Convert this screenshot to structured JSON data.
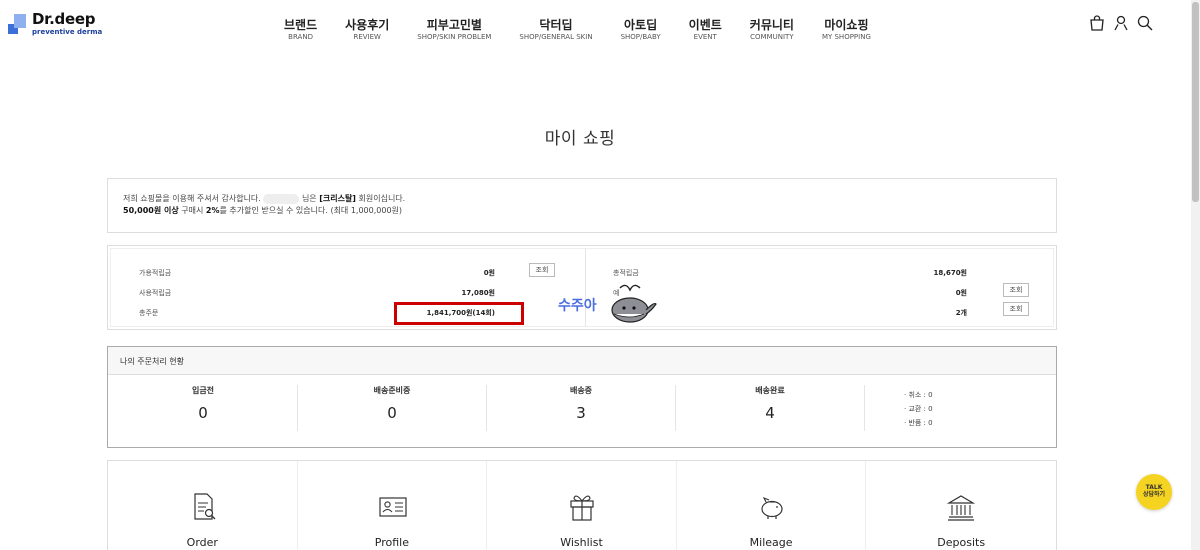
{
  "header": {
    "logo_text": "Dr.deep",
    "logo_sub": "preventive derma",
    "nav": [
      {
        "kr": "브랜드",
        "en": "BRAND"
      },
      {
        "kr": "사용후기",
        "en": "REVIEW"
      },
      {
        "kr": "피부고민별",
        "en": "SHOP/SKIN PROBLEM"
      },
      {
        "kr": "닥터딥",
        "en": "SHOP/GENERAL SKIN"
      },
      {
        "kr": "아토딥",
        "en": "SHOP/BABY"
      },
      {
        "kr": "이벤트",
        "en": "EVENT"
      },
      {
        "kr": "커뮤니티",
        "en": "COMMUNITY"
      },
      {
        "kr": "마이쇼핑",
        "en": "MY SHOPPING"
      }
    ],
    "icons": [
      "bag-icon",
      "user-icon",
      "search-icon"
    ]
  },
  "page_title": "마이 쇼핑",
  "member": {
    "line1_prefix": "저희 쇼핑몰을 이용해 주셔서 감사합니다.",
    "line1_mid": "님은 ",
    "grade": "[크리스탈]",
    "line1_suffix": " 회원이십니다.",
    "line2_bold": "50,000원 이상",
    "line2_mid": " 구매시 ",
    "line2_pct": "2%",
    "line2_suffix": "를 추가할인 받으실 수 있습니다. (최대 1,000,000원)"
  },
  "points": {
    "available_label": "가용적립금",
    "available_value": "0원",
    "used_label": "사용적립금",
    "used_value": "17,080원",
    "total_order_label": "총주문",
    "total_order_value": "1,841,700원(14회)",
    "total_points_label": "총적립금",
    "total_points_value": "18,670원",
    "deposit_label": "예",
    "deposit_value": "0원",
    "coupon_label": "",
    "coupon_value": "2개",
    "lookup": "조회"
  },
  "watermark": "수주아",
  "orders": {
    "title": "나의 주문처리 현황",
    "stats": [
      {
        "label": "입금전",
        "value": "0"
      },
      {
        "label": "배송준비중",
        "value": "0"
      },
      {
        "label": "배송중",
        "value": "3"
      },
      {
        "label": "배송완료",
        "value": "4"
      }
    ],
    "side": [
      "취소 : 0",
      "교환 : 0",
      "반품 : 0"
    ]
  },
  "menu": [
    {
      "label": "Order",
      "icon": "order-icon"
    },
    {
      "label": "Profile",
      "icon": "profile-icon"
    },
    {
      "label": "Wishlist",
      "icon": "gift-icon"
    },
    {
      "label": "Mileage",
      "icon": "piggybank-icon"
    },
    {
      "label": "Deposits",
      "icon": "bank-icon"
    }
  ],
  "talk": {
    "line1": "TALK",
    "line2": "상담하기"
  }
}
